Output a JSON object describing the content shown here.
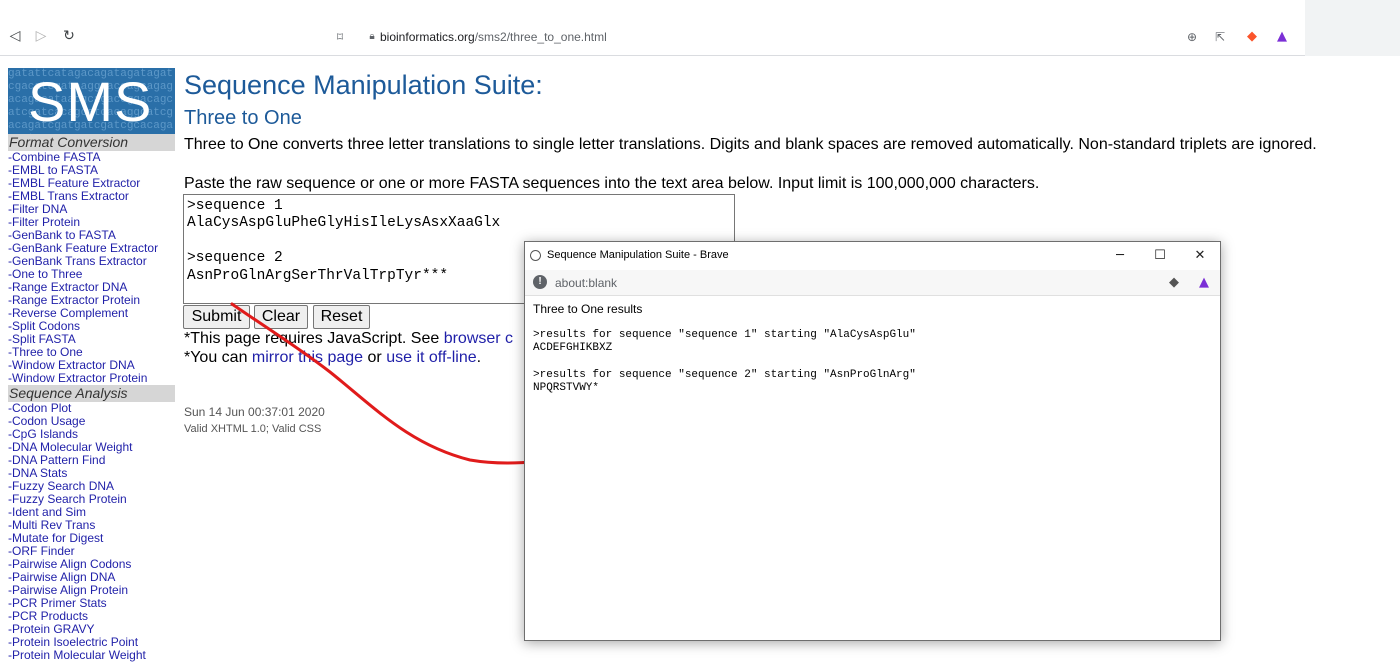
{
  "browser": {
    "url_host": "bioinformatics.org",
    "url_path": "/sms2/three_to_one.html"
  },
  "logo": {
    "text": "SMS",
    "bg_sequence": "gatattcatagacagatagatagatcgacatcgataaggcaccagcagagacagacataacgcagaccggacagcatcgatcacagcatcacaggcatcgacagatcgatgatcgatcgcacagacgatag"
  },
  "sidebar": {
    "sections": [
      {
        "title": "Format Conversion",
        "items": [
          "-Combine FASTA",
          "-EMBL to FASTA",
          "-EMBL Feature Extractor",
          "-EMBL Trans Extractor",
          "-Filter DNA",
          "-Filter Protein",
          "-GenBank to FASTA",
          "-GenBank Feature Extractor",
          "-GenBank Trans Extractor",
          "-One to Three",
          "-Range Extractor DNA",
          "-Range Extractor Protein",
          "-Reverse Complement",
          "-Split Codons",
          "-Split FASTA",
          "-Three to One",
          "-Window Extractor DNA",
          "-Window Extractor Protein"
        ]
      },
      {
        "title": "Sequence Analysis",
        "items": [
          "-Codon Plot",
          "-Codon Usage",
          "-CpG Islands",
          "-DNA Molecular Weight",
          "-DNA Pattern Find",
          "-DNA Stats",
          "-Fuzzy Search DNA",
          "-Fuzzy Search Protein",
          "-Ident and Sim",
          "-Multi Rev Trans",
          "-Mutate for Digest",
          "-ORF Finder",
          "-Pairwise Align Codons",
          "-Pairwise Align DNA",
          "-Pairwise Align Protein",
          "-PCR Primer Stats",
          "-PCR Products",
          "-Protein GRAVY",
          "-Protein Isoelectric Point",
          "-Protein Molecular Weight"
        ]
      }
    ]
  },
  "main": {
    "title": "Sequence Manipulation Suite:",
    "subtitle": "Three to One",
    "description": "Three to One converts three letter translations to single letter translations. Digits and blank spaces are removed automatically. Non-standard triplets are ignored.",
    "paste_instructions": "Paste the raw sequence or one or more FASTA sequences into the text area below. Input limit is 100,000,000 characters.",
    "sequence_input": ">sequence 1\nAlaCysAspGluPheGlyHisIleLysAsxXaaGlx\n\n>sequence 2\nAsnProGlnArgSerThrValTrpTyr***",
    "buttons": {
      "submit": "Submit",
      "clear": "Clear",
      "reset": "Reset"
    },
    "js_note_prefix": "*This page requires JavaScript. See ",
    "js_note_link": "browser c",
    "mirror_prefix": "*You can ",
    "mirror_link": "mirror this page",
    "mirror_mid": " or ",
    "offline_link": "use it off-line",
    "mirror_suffix": ".",
    "date": "Sun 14 Jun 00:37:01 2020",
    "valid": "Valid XHTML 1.0; Valid CSS"
  },
  "popup": {
    "window_title": "Sequence Manipulation Suite - Brave",
    "address": "about:blank",
    "results_title": "Three to One results",
    "results": [
      {
        "header": ">results for sequence \"sequence 1\" starting \"AlaCysAspGlu\"",
        "value": "ACDEFGHIKBXZ"
      },
      {
        "header": ">results for sequence \"sequence 2\" starting \"AsnProGlnArg\"",
        "value": "NPQRSTVWY*"
      }
    ]
  },
  "annotation": {
    "arrow_color": "#e01b1b"
  }
}
